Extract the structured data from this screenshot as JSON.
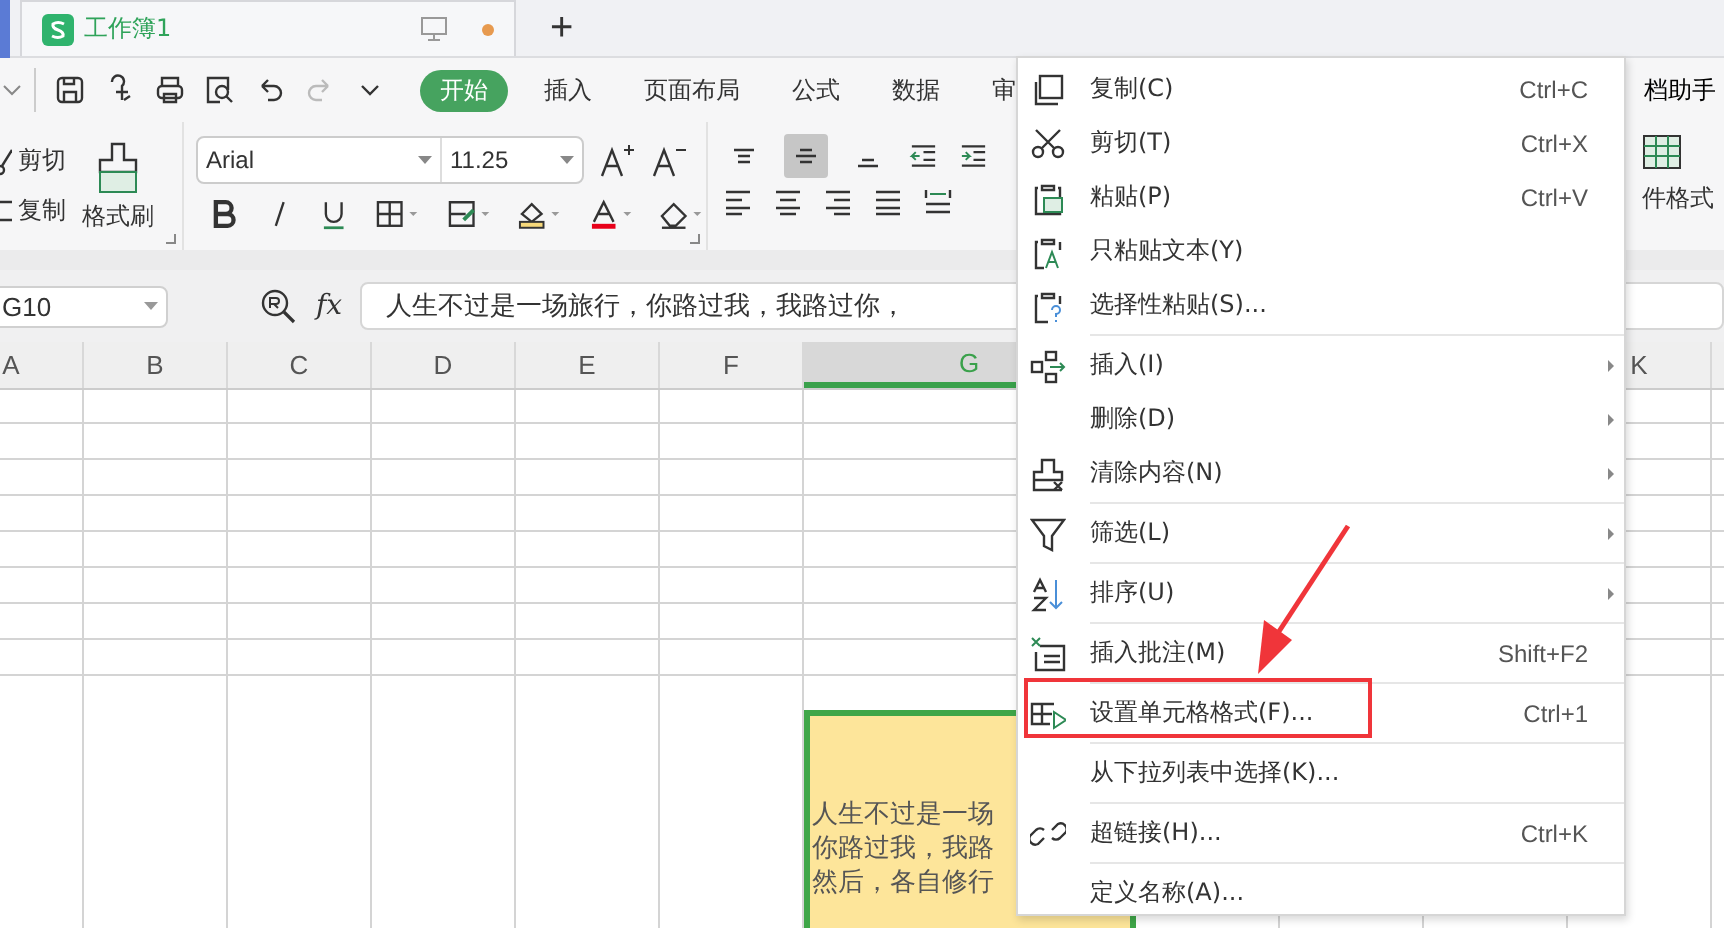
{
  "tabbar": {
    "doc_tab": {
      "title": "工作簿1",
      "unsaved": true
    },
    "new_tab": "+"
  },
  "toolbar": {
    "ribbon_tabs": [
      {
        "label": "开始",
        "selected": true
      },
      {
        "label": "插入",
        "selected": false
      },
      {
        "label": "页面布局",
        "selected": false
      },
      {
        "label": "公式",
        "selected": false
      },
      {
        "label": "数据",
        "selected": false
      },
      {
        "label": "审",
        "selected": false
      }
    ],
    "assistant": "档助手"
  },
  "ribbon": {
    "cut": "剪切",
    "copy": "复制",
    "format_painter": "格式刷",
    "font": "Arial",
    "font_size": "11.25",
    "conditional_format": "件格式",
    "vertical_align": [
      {
        "selected": false
      },
      {
        "selected": true
      },
      {
        "selected": false
      }
    ]
  },
  "formula_bar": {
    "cell_ref": "G10",
    "fx": "fx",
    "formula": "人生不过是一场旅行，你路过我，我路过你，"
  },
  "sheet": {
    "columns": [
      {
        "label": "A",
        "selected": false
      },
      {
        "label": "B",
        "selected": false
      },
      {
        "label": "C",
        "selected": false
      },
      {
        "label": "D",
        "selected": false
      },
      {
        "label": "E",
        "selected": false
      },
      {
        "label": "F",
        "selected": false
      },
      {
        "label": "G",
        "selected": true
      },
      {
        "label": "K",
        "selected": false
      }
    ],
    "selected_cell": {
      "lines": [
        "人生不过是一场",
        "你路过我，我路",
        "然后，各自修行"
      ]
    }
  },
  "context_menu": {
    "items": [
      {
        "label": "复制(C)",
        "shortcut": "Ctrl+C",
        "submenu": false,
        "separator_before": false
      },
      {
        "label": "剪切(T)",
        "shortcut": "Ctrl+X",
        "submenu": false,
        "separator_before": false
      },
      {
        "label": "粘贴(P)",
        "shortcut": "Ctrl+V",
        "submenu": false,
        "separator_before": false
      },
      {
        "label": "只粘贴文本(Y)",
        "submenu": false,
        "separator_before": false
      },
      {
        "label": "选择性粘贴(S)...",
        "submenu": false,
        "separator_before": false
      },
      {
        "label": "插入(I)",
        "submenu": true,
        "separator_before": true
      },
      {
        "label": "删除(D)",
        "submenu": true,
        "separator_before": false
      },
      {
        "label": "清除内容(N)",
        "submenu": true,
        "separator_before": false
      },
      {
        "label": "筛选(L)",
        "submenu": true,
        "separator_before": true
      },
      {
        "label": "排序(U)",
        "submenu": true,
        "separator_before": true
      },
      {
        "label": "插入批注(M)",
        "shortcut": "Shift+F2",
        "submenu": false,
        "separator_before": true
      },
      {
        "label": "设置单元格格式(F)...",
        "shortcut": "Ctrl+1",
        "submenu": false,
        "separator_before": true
      },
      {
        "label": "从下拉列表中选择(K)...",
        "submenu": false,
        "separator_before": true
      },
      {
        "label": "超链接(H)...",
        "shortcut": "Ctrl+K",
        "submenu": false,
        "separator_before": true
      },
      {
        "label": "定义名称(A)...",
        "submenu": false,
        "separator_before": true
      }
    ]
  },
  "annotations": {
    "highlight_box": true,
    "pointer_arrow": true
  }
}
